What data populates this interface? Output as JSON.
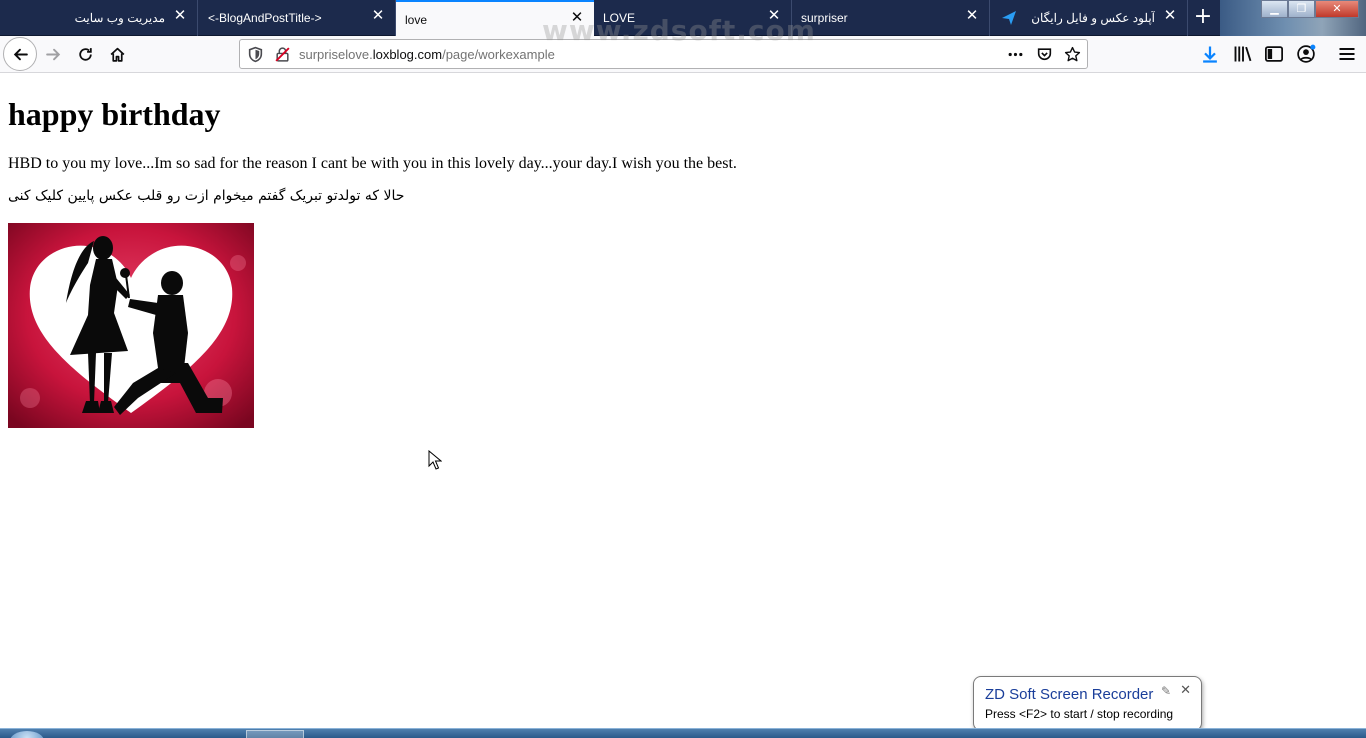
{
  "browser": {
    "tabs": [
      {
        "title": "مدیریت وب سایت",
        "rtl": true,
        "active": false
      },
      {
        "title": "<-BlogAndPostTitle->",
        "rtl": false,
        "active": false
      },
      {
        "title": "love",
        "rtl": false,
        "active": true
      },
      {
        "title": "LOVE",
        "rtl": false,
        "active": false
      },
      {
        "title": "surpriser",
        "rtl": false,
        "active": false
      },
      {
        "title": "آپلود عکس و فایل رایگان",
        "rtl": true,
        "active": false
      }
    ],
    "new_tab_label": "+",
    "url": {
      "prefix": "surpriselove.",
      "host": "loxblog.com",
      "path": "/page/workexample"
    },
    "watermark": "www.zdsoft.com",
    "accent_color": "#0a84ff"
  },
  "page": {
    "heading": "happy birthday",
    "paragraph_en": "HBD to you my love...Im so sad for the reason I cant be with you in this lovely day...your day.I wish you the best.",
    "paragraph_fa": "حالا که تولدتو تبریک گفتم میخوام ازت رو قلب عکس پایین کلیک کنی"
  },
  "recorder": {
    "title": "ZD Soft Screen Recorder",
    "hint": "Press <F2> to start / stop recording"
  }
}
